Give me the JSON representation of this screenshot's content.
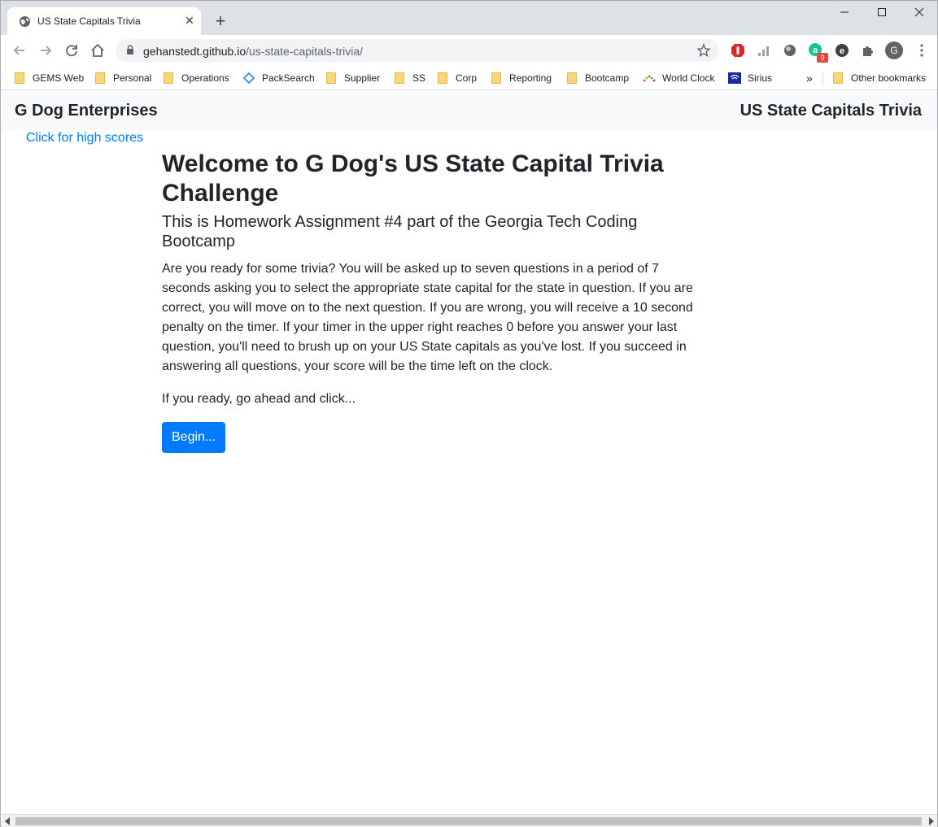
{
  "browser": {
    "tab_title": "US State Capitals Trivia",
    "tab_close": "✕",
    "new_tab": "+",
    "minimize": "—",
    "maximize": "☐",
    "close": "✕",
    "url_host": "gehanstedt.github.io",
    "url_path": "/us-state-capitals-trivia/",
    "extension_badge": "9",
    "profile_initial": "G",
    "bookmarks_overflow": "»",
    "bookmarks": [
      {
        "label": "GEMS Web",
        "icon": "folder-icon"
      },
      {
        "label": "Personal",
        "icon": "folder-icon"
      },
      {
        "label": "Operations",
        "icon": "folder-icon"
      },
      {
        "label": "PackSearch",
        "icon": "packsearch-icon"
      },
      {
        "label": "Supplier",
        "icon": "folder-icon"
      },
      {
        "label": "SS",
        "icon": "folder-icon"
      },
      {
        "label": "Corp",
        "icon": "folder-icon"
      },
      {
        "label": "Reporting",
        "icon": "folder-icon"
      },
      {
        "label": "Bootcamp",
        "icon": "folder-icon"
      },
      {
        "label": "World Clock",
        "icon": "world-clock-icon"
      },
      {
        "label": "Sirius",
        "icon": "sirius-icon"
      }
    ],
    "other_bookmarks": "Other bookmarks"
  },
  "page": {
    "brand": "G Dog Enterprises",
    "nav_right": "US State Capitals Trivia",
    "high_scores_link": "Click for high scores",
    "heading": "Welcome to G Dog's US State Capital Trivia Challenge",
    "subheading": "This is Homework Assignment #4 part of the Georgia Tech Coding Bootcamp",
    "description": "Are you ready for some trivia? You will be asked up to seven questions in a period of 7 seconds asking you to select the appropriate state capital for the state in question. If you are correct, you will move on to the next question. If you are wrong, you will receive a 10 second penalty on the timer. If your timer in the upper right reaches 0 before you answer your last question, you'll need to brush up on your US State capitals as you've lost. If you succeed in answering all questions, your score will be the time left on the clock.",
    "prompt": "If you ready, go ahead and click...",
    "begin_button": "Begin..."
  },
  "colors": {
    "primary": "#007bff",
    "navbar_bg": "#f8f9fa",
    "text": "#212529"
  }
}
